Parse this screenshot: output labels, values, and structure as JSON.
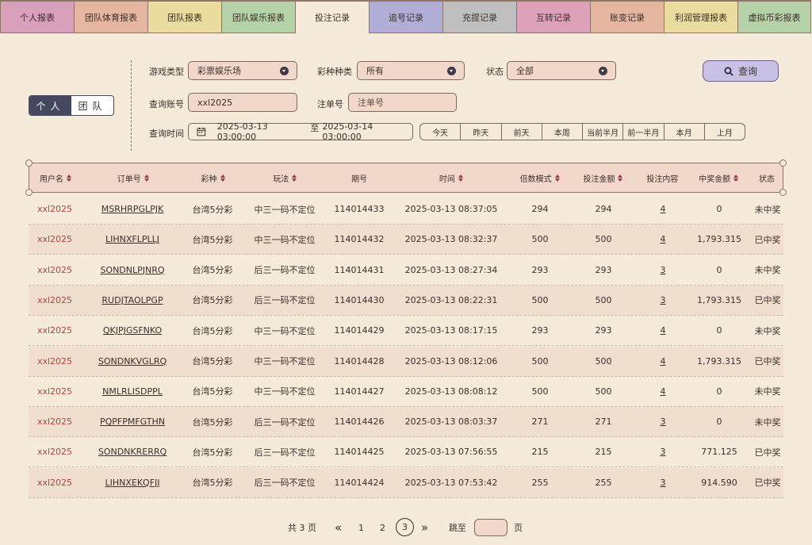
{
  "tabs": [
    {
      "label": "个人报表",
      "color": "#d9a0bb"
    },
    {
      "label": "团队体育报表",
      "color": "#e5b7a1"
    },
    {
      "label": "团队报表",
      "color": "#eadc9f"
    },
    {
      "label": "团队娱乐报表",
      "color": "#b6d2a8"
    },
    {
      "label": "投注记录",
      "color": "#f6eadb"
    },
    {
      "label": "追号记录",
      "color": "#b0aed6"
    },
    {
      "label": "充提记录",
      "color": "#bfbfbf"
    },
    {
      "label": "互转记录",
      "color": "#dca0b8"
    },
    {
      "label": "账变记录",
      "color": "#e5b7a1"
    },
    {
      "label": "利润管理报表",
      "color": "#eadc9f"
    },
    {
      "label": "虚拟币彩报表",
      "color": "#b6d2a8"
    }
  ],
  "toggle": {
    "personal": "个人",
    "team": "团队"
  },
  "filters": {
    "game_type_label": "游戏类型",
    "game_type_value": "彩票娱乐场",
    "lottery_label": "彩种种类",
    "lottery_value": "所有",
    "status_label": "状态",
    "status_value": "全部",
    "account_label": "查询账号",
    "account_value": "xxl2025",
    "order_label": "注单号",
    "order_placeholder": "注单号",
    "time_label": "查询时间",
    "date_start": "2025-03-13 03:00:00",
    "date_sep": "至",
    "date_end": "2025-03-14 03:00:00",
    "query_button": "查询",
    "quick": [
      "今天",
      "昨天",
      "前天",
      "本周",
      "当前半月",
      "前一半月",
      "本月",
      "上月"
    ]
  },
  "table": {
    "headers": [
      "用户名",
      "订单号",
      "彩种",
      "玩法",
      "期号",
      "时间",
      "倍数模式",
      "投注金额",
      "投注内容",
      "中奖金额",
      "状态"
    ],
    "rows": [
      [
        "xxl2025",
        "MSRHRPGLPJK",
        "台湾5分彩",
        "中三一码不定位",
        "114014433",
        "2025-03-13 08:37:05",
        "294",
        "294",
        "4",
        "0",
        "未中奖"
      ],
      [
        "xxl2025",
        "LIHNXFLPLLJ",
        "台湾5分彩",
        "中三一码不定位",
        "114014432",
        "2025-03-13 08:32:37",
        "500",
        "500",
        "4",
        "1,793.315",
        "已中奖"
      ],
      [
        "xxl2025",
        "SONDNLPJNRQ",
        "台湾5分彩",
        "后三一码不定位",
        "114014431",
        "2025-03-13 08:27:34",
        "293",
        "293",
        "3",
        "0",
        "未中奖"
      ],
      [
        "xxl2025",
        "RUDJTAOLPGP",
        "台湾5分彩",
        "后三一码不定位",
        "114014430",
        "2025-03-13 08:22:31",
        "500",
        "500",
        "3",
        "1,793.315",
        "已中奖"
      ],
      [
        "xxl2025",
        "QKJPJGSFNKO",
        "台湾5分彩",
        "中三一码不定位",
        "114014429",
        "2025-03-13 08:17:15",
        "293",
        "293",
        "4",
        "0",
        "未中奖"
      ],
      [
        "xxl2025",
        "SONDNKVGLRQ",
        "台湾5分彩",
        "中三一码不定位",
        "114014428",
        "2025-03-13 08:12:06",
        "500",
        "500",
        "4",
        "1,793.315",
        "已中奖"
      ],
      [
        "xxl2025",
        "NMLRLISDPPL",
        "台湾5分彩",
        "中三一码不定位",
        "114014427",
        "2025-03-13 08:08:12",
        "500",
        "500",
        "4",
        "0",
        "未中奖"
      ],
      [
        "xxl2025",
        "PQPFPMFGTHN",
        "台湾5分彩",
        "后三一码不定位",
        "114014426",
        "2025-03-13 08:03:37",
        "271",
        "271",
        "3",
        "0",
        "未中奖"
      ],
      [
        "xxl2025",
        "SONDNKRERRQ",
        "台湾5分彩",
        "后三一码不定位",
        "114014425",
        "2025-03-13 07:56:55",
        "215",
        "215",
        "3",
        "771.125",
        "已中奖"
      ],
      [
        "xxl2025",
        "LIHNXEKQFJJ",
        "台湾5分彩",
        "后三一码不定位",
        "114014424",
        "2025-03-13 07:53:42",
        "255",
        "255",
        "3",
        "914.590",
        "已中奖"
      ]
    ]
  },
  "pagination": {
    "total": "共 3 页",
    "prev": "«",
    "p1": "1",
    "p2": "2",
    "p3": "3",
    "next": "»",
    "jump_label": "跳至",
    "page_suffix": "页"
  }
}
